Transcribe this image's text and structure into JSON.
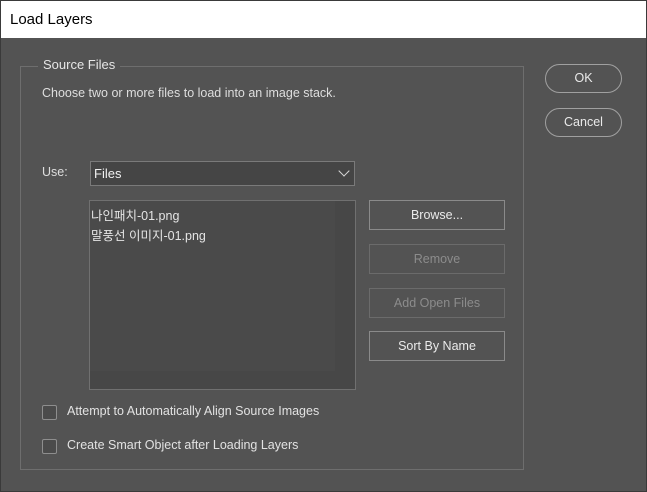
{
  "window": {
    "title": "Load Layers"
  },
  "source_files": {
    "legend": "Source Files",
    "description": "Choose two or more files to load into an image stack.",
    "use_label": "Use:",
    "use_select": {
      "value": "Files",
      "icon": "chevron-down-icon"
    },
    "files": [
      "나인패치-01.png",
      "말풍선 이미지-01.png"
    ],
    "buttons": {
      "browse": "Browse...",
      "remove": "Remove",
      "add_open_files": "Add Open Files",
      "sort_by_name": "Sort By Name"
    },
    "options": {
      "auto_align": {
        "label": "Attempt to Automatically Align Source Images",
        "checked": false
      },
      "smart_object": {
        "label": "Create Smart Object after Loading Layers",
        "checked": false
      }
    }
  },
  "dialog_buttons": {
    "ok": "OK",
    "cancel": "Cancel"
  }
}
